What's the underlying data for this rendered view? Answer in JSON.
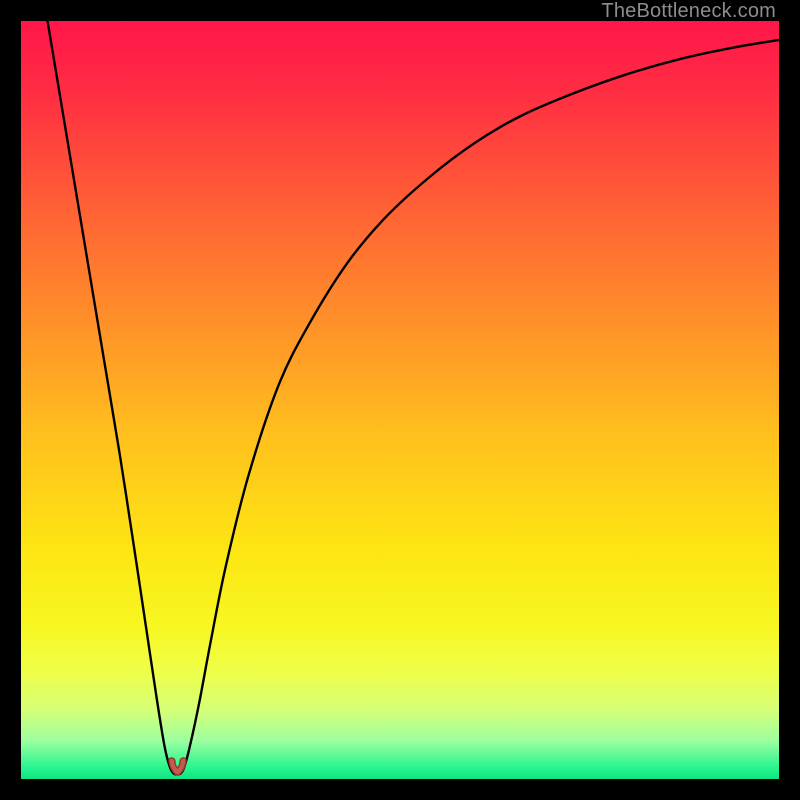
{
  "watermark": "TheBottleneck.com",
  "colors": {
    "background": "#000000",
    "gradient_stops": [
      {
        "offset": 0.0,
        "color": "#ff1649"
      },
      {
        "offset": 0.1,
        "color": "#ff2f42"
      },
      {
        "offset": 0.25,
        "color": "#ff6235"
      },
      {
        "offset": 0.4,
        "color": "#ff9129"
      },
      {
        "offset": 0.55,
        "color": "#ffc11d"
      },
      {
        "offset": 0.7,
        "color": "#fde613"
      },
      {
        "offset": 0.8,
        "color": "#f7f722"
      },
      {
        "offset": 0.86,
        "color": "#eeff4a"
      },
      {
        "offset": 0.91,
        "color": "#d4ff78"
      },
      {
        "offset": 0.95,
        "color": "#9bffa0"
      },
      {
        "offset": 0.985,
        "color": "#28f58f"
      },
      {
        "offset": 1.0,
        "color": "#0ee582"
      }
    ],
    "curve": "#000000",
    "marker_fill": "#c85a4a",
    "marker_stroke": "#8f3b2f",
    "watermark": "#8d8d8d"
  },
  "chart_data": {
    "type": "line",
    "title": "",
    "xlabel": "",
    "ylabel": "",
    "xlim": [
      0,
      100
    ],
    "ylim": [
      0,
      100
    ],
    "note": "x is horizontal position in % of plot width (0=left, 100=right); y is height above bottom in % of plot height (0=bottom, 100=top). Background color maps y to bottleneck severity: red≈100 (bad), green≈0 (good).",
    "series": [
      {
        "name": "bottleneck-curve",
        "x": [
          3.5,
          5,
          7,
          9,
          11,
          13,
          15,
          16.5,
          18,
          19,
          19.8,
          20.6,
          21.4,
          22.2,
          23.5,
          25,
          27,
          30,
          34,
          38,
          43,
          48,
          54,
          60,
          66,
          73,
          80,
          87,
          94,
          100
        ],
        "y": [
          100,
          91,
          79,
          67,
          55,
          43,
          30,
          20,
          10,
          4,
          1.2,
          0.6,
          1.2,
          4,
          10,
          18,
          28,
          40,
          52,
          60,
          68,
          74,
          79.5,
          84,
          87.5,
          90.5,
          93,
          95,
          96.5,
          97.5
        ]
      }
    ],
    "marker": {
      "x": 20.6,
      "y": 0.6,
      "shape": "double-dip"
    }
  }
}
